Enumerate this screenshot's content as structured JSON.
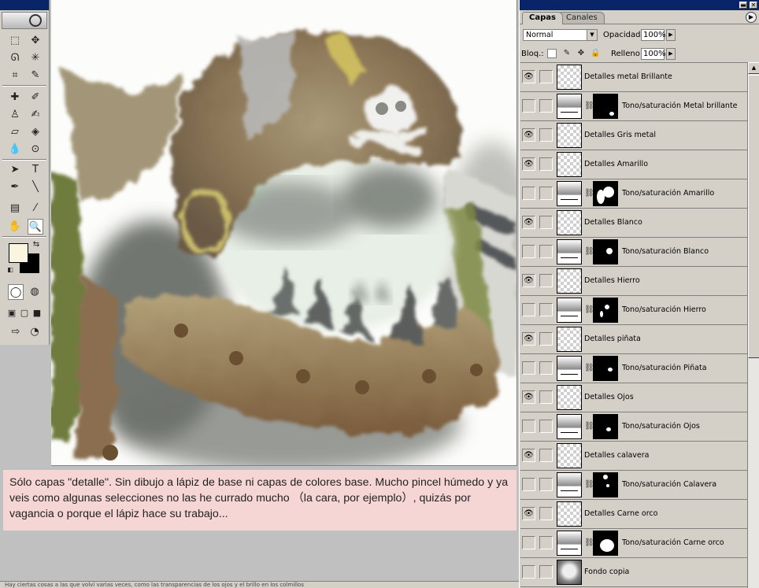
{
  "toolbox": {
    "tools": [
      {
        "name": "marquee-tool-icon",
        "glyph": "⬚"
      },
      {
        "name": "move-tool-icon",
        "glyph": "✥"
      },
      {
        "name": "lasso-tool-icon",
        "glyph": "ᘏ"
      },
      {
        "name": "magic-wand-tool-icon",
        "glyph": "✳"
      },
      {
        "name": "crop-tool-icon",
        "glyph": "⌗"
      },
      {
        "name": "slice-tool-icon",
        "glyph": "✎"
      },
      {
        "name": "healing-brush-tool-icon",
        "glyph": "✚"
      },
      {
        "name": "brush-tool-icon",
        "glyph": "✐"
      },
      {
        "name": "clone-stamp-tool-icon",
        "glyph": "♙"
      },
      {
        "name": "history-brush-tool-icon",
        "glyph": "✍"
      },
      {
        "name": "eraser-tool-icon",
        "glyph": "▱"
      },
      {
        "name": "paint-bucket-tool-icon",
        "glyph": "◈"
      },
      {
        "name": "blur-tool-icon",
        "glyph": "💧"
      },
      {
        "name": "dodge-tool-icon",
        "glyph": "⊙"
      },
      {
        "name": "path-selection-tool-icon",
        "glyph": "➤"
      },
      {
        "name": "type-tool-icon",
        "glyph": "T"
      },
      {
        "name": "pen-tool-icon",
        "glyph": "✒"
      },
      {
        "name": "line-tool-icon",
        "glyph": "╲"
      },
      {
        "name": "notes-tool-icon",
        "glyph": "▤"
      },
      {
        "name": "eyedropper-tool-icon",
        "glyph": "⁄"
      },
      {
        "name": "hand-tool-icon",
        "glyph": "✋"
      },
      {
        "name": "zoom-tool-icon",
        "glyph": "🔍"
      }
    ],
    "foreground_color": "#fbf4df",
    "background_color": "#000000"
  },
  "caption": {
    "text": "Sólo capas \"detalle\". Sin dibujo a lápiz de base ni capas de colores base. Mucho pincel húmedo y ya veis como algunas selecciones no las he currado mucho （la cara, por ejemplo）, quizás por vagancia o porque el lápiz hace su trabajo..."
  },
  "status_bar": {
    "text": "Hay ciertas cosas a las que volví varias veces, como las transparencias de los ojos y el brillo en los colmillos"
  },
  "layers_panel": {
    "tabs": [
      {
        "label": "Capas",
        "active": true
      },
      {
        "label": "Canales",
        "active": false
      }
    ],
    "blend_mode": "Normal",
    "opacity_label": "Opacidad:",
    "opacity_value": "100%",
    "lock_label": "Bloq.:",
    "fill_label": "Relleno:",
    "fill_value": "100%",
    "layers": [
      {
        "name": "Detalles metal Brillante",
        "type": "pixel",
        "visible": true
      },
      {
        "name": "Tono/saturación Metal brillante",
        "type": "adjustment",
        "visible": false
      },
      {
        "name": "Detalles Gris metal",
        "type": "pixel",
        "visible": true
      },
      {
        "name": "Detalles Amarillo",
        "type": "pixel",
        "visible": true
      },
      {
        "name": "Tono/saturación Amarillo",
        "type": "adjustment",
        "visible": false
      },
      {
        "name": "Detalles Blanco",
        "type": "pixel",
        "visible": true
      },
      {
        "name": "Tono/saturación Blanco",
        "type": "adjustment",
        "visible": false
      },
      {
        "name": "Detalles Hierro",
        "type": "pixel",
        "visible": true
      },
      {
        "name": "Tono/saturación Hierro",
        "type": "adjustment",
        "visible": false
      },
      {
        "name": "Detalles piñata",
        "type": "pixel",
        "visible": true
      },
      {
        "name": "Tono/saturación Piñata",
        "type": "adjustment",
        "visible": false
      },
      {
        "name": "Detalles Ojos",
        "type": "pixel",
        "visible": true
      },
      {
        "name": "Tono/saturación Ojos",
        "type": "adjustment",
        "visible": false
      },
      {
        "name": "Detalles calavera",
        "type": "pixel",
        "visible": true
      },
      {
        "name": "Tono/saturación Calavera",
        "type": "adjustment",
        "visible": false
      },
      {
        "name": "Detalles Carne orco",
        "type": "pixel",
        "visible": true
      },
      {
        "name": "Tono/saturación Carne orco",
        "type": "adjustment",
        "visible": false
      },
      {
        "name": "Fondo copia",
        "type": "pixel",
        "visible": false
      }
    ]
  }
}
